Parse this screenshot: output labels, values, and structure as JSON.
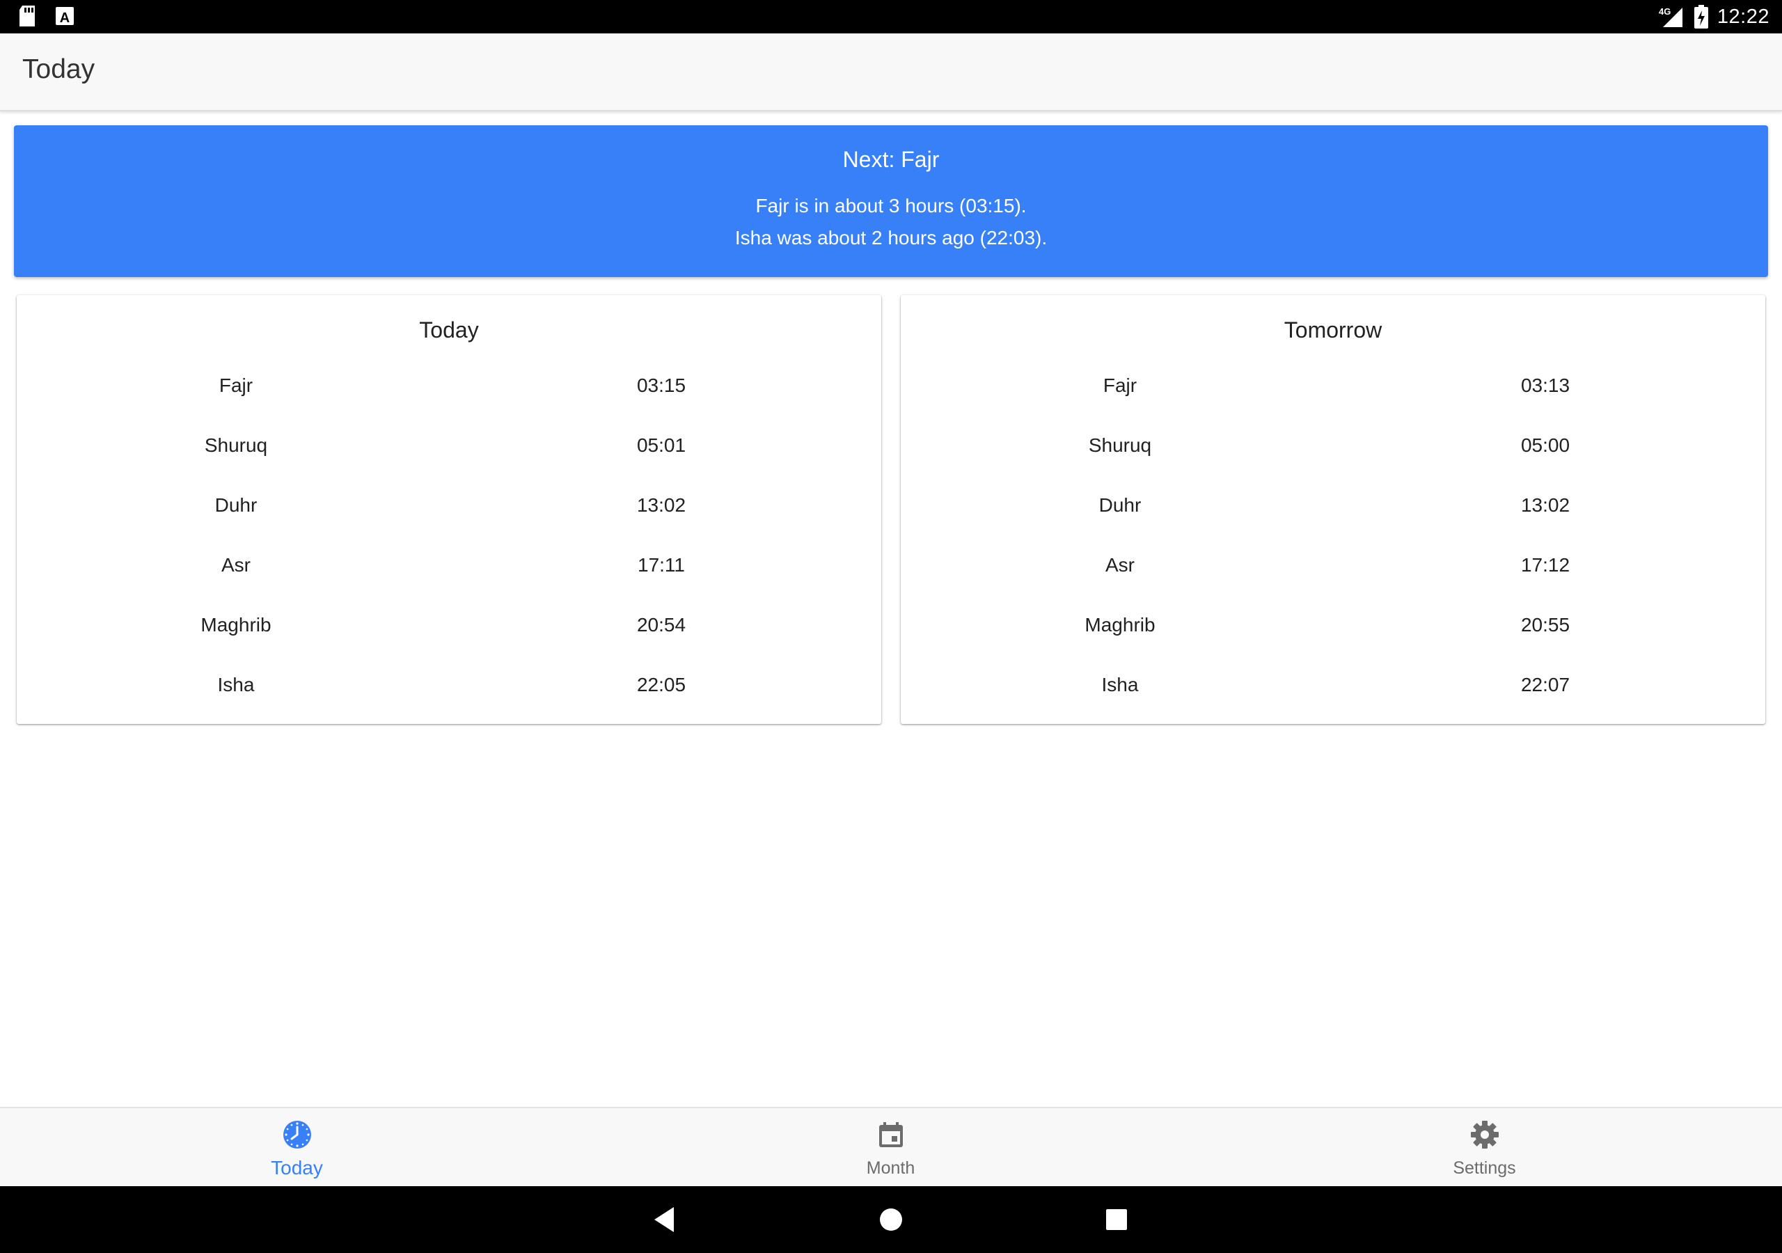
{
  "status_bar": {
    "time": "12:22",
    "network": "4G",
    "left_icons": [
      "sd-card-icon",
      "a-notification-icon"
    ],
    "right_icons": [
      "signal-icon",
      "battery-charging-icon"
    ]
  },
  "app_bar": {
    "title": "Today"
  },
  "next_banner": {
    "heading": "Next: Fajr",
    "line1": "Fajr is in about 3 hours (03:15).",
    "line2": "Isha was about 2 hours ago (22:03).",
    "background_color": "#3880f7"
  },
  "cards": {
    "today": {
      "title": "Today",
      "rows": [
        {
          "name": "Fajr",
          "time": "03:15"
        },
        {
          "name": "Shuruq",
          "time": "05:01"
        },
        {
          "name": "Duhr",
          "time": "13:02"
        },
        {
          "name": "Asr",
          "time": "17:11"
        },
        {
          "name": "Maghrib",
          "time": "20:54"
        },
        {
          "name": "Isha",
          "time": "22:05"
        }
      ]
    },
    "tomorrow": {
      "title": "Tomorrow",
      "rows": [
        {
          "name": "Fajr",
          "time": "03:13"
        },
        {
          "name": "Shuruq",
          "time": "05:00"
        },
        {
          "name": "Duhr",
          "time": "13:02"
        },
        {
          "name": "Asr",
          "time": "17:12"
        },
        {
          "name": "Maghrib",
          "time": "20:55"
        },
        {
          "name": "Isha",
          "time": "22:07"
        }
      ]
    }
  },
  "bottom_nav": {
    "items": [
      {
        "label": "Today",
        "icon": "clock-icon",
        "active": true
      },
      {
        "label": "Month",
        "icon": "calendar-icon",
        "active": false
      },
      {
        "label": "Settings",
        "icon": "gear-icon",
        "active": false
      }
    ],
    "active_color": "#3880f7",
    "inactive_color": "#6c6c6c"
  },
  "system_nav": {
    "buttons": [
      "back-icon",
      "home-icon",
      "recents-icon"
    ]
  }
}
